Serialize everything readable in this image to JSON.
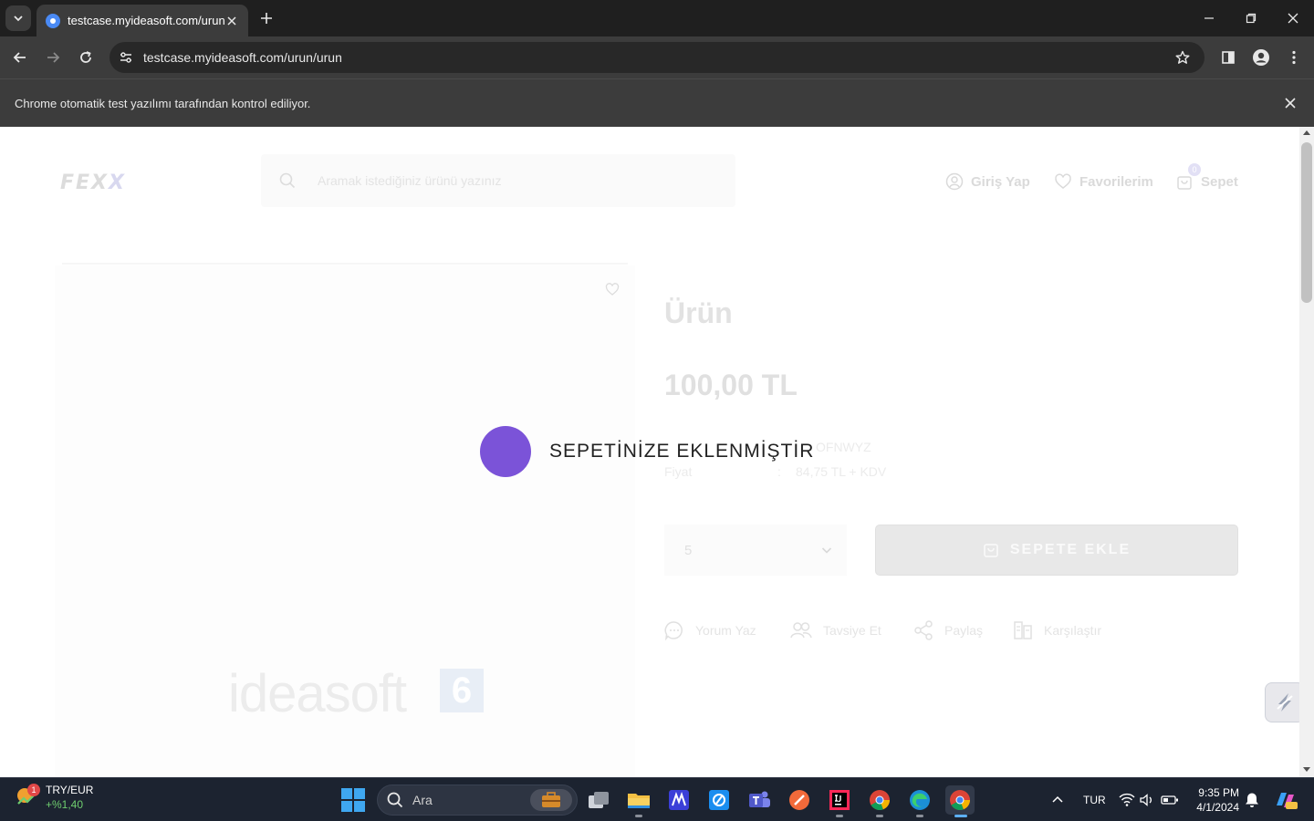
{
  "browser": {
    "tab_title": "testcase.myideasoft.com/urun/urun",
    "url": "testcase.myideasoft.com/urun/urun",
    "infobar_text": "Chrome otomatik test yazılımı tarafından kontrol ediliyor."
  },
  "site": {
    "logo_main": "FEX",
    "logo_accent": "X",
    "search_placeholder": "Aramak istediğiniz ürünü yazınız",
    "login_label": "Giriş Yap",
    "favorites_label": "Favorilerim",
    "cart_label": "Sepet",
    "cart_count": "0"
  },
  "product": {
    "title": "Ürün",
    "price": "100,00 TL",
    "code": "OFNWYZ",
    "price_label": "Fiyat",
    "price_sep": ":",
    "price_detail": "84,75 TL + KDV",
    "quantity": "5",
    "add_to_cart": "SEPETE EKLE",
    "actions": {
      "comment": "Yorum Yaz",
      "recommend": "Tavsiye Et",
      "share": "Paylaş",
      "compare": "Karşılaştır"
    },
    "gallery_logo": "ideasoft",
    "gallery_logo_num": "6"
  },
  "toast": {
    "message": "SEPETİNİZE EKLENMİŞTİR",
    "dot_color": "#7b53d8"
  },
  "taskbar": {
    "widget_title": "TRY/EUR",
    "widget_change": "+%1,40",
    "widget_badge": "1",
    "search_label": "Ara",
    "language": "TUR",
    "time": "9:35 PM",
    "date": "4/1/2024"
  }
}
